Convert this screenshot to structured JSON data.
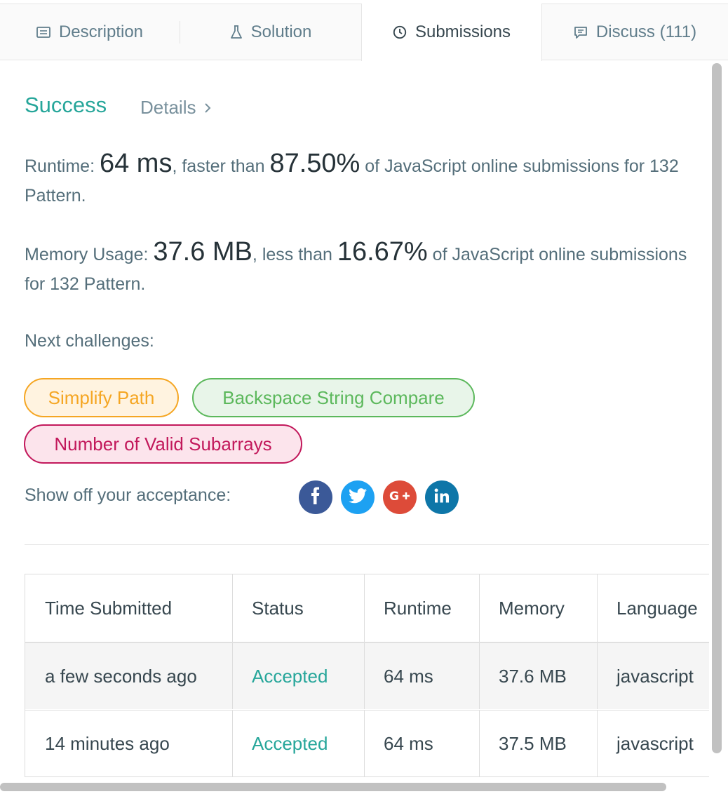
{
  "tabs": [
    {
      "label": "Description",
      "icon": "description-icon"
    },
    {
      "label": "Solution",
      "icon": "flask-icon"
    },
    {
      "label": "Submissions",
      "icon": "clock-icon",
      "active": true
    },
    {
      "label": "Discuss (111)",
      "icon": "comment-icon"
    }
  ],
  "result": {
    "status": "Success",
    "details_label": "Details",
    "runtime_label": "Runtime: ",
    "runtime_value": "64 ms",
    "runtime_mid": ", faster than ",
    "runtime_percent": "87.50%",
    "runtime_tail": " of JavaScript online submissions for 132 Pattern.",
    "memory_label": "Memory Usage: ",
    "memory_value": "37.6 MB",
    "memory_mid": ", less than ",
    "memory_percent": "16.67%",
    "memory_tail": " of JavaScript online submissions for 132 Pattern."
  },
  "next": {
    "label": "Next challenges:",
    "challenges": [
      {
        "title": "Simplify Path",
        "difficulty": "medium",
        "color": "#f5a623"
      },
      {
        "title": "Backspace String Compare",
        "difficulty": "easy",
        "color": "#5cb85c"
      },
      {
        "title": "Number of Valid Subarrays",
        "difficulty": "hard",
        "color": "#c2185b"
      }
    ]
  },
  "share": {
    "label": "Show off your acceptance:",
    "networks": [
      {
        "icon": "facebook-icon",
        "color": "#3b5998"
      },
      {
        "icon": "twitter-icon",
        "color": "#1da1f2"
      },
      {
        "icon": "google-plus-icon",
        "color": "#dd4b39"
      },
      {
        "icon": "linkedin-icon",
        "color": "#0e76a8"
      }
    ]
  },
  "table": {
    "headers": [
      "Time Submitted",
      "Status",
      "Runtime",
      "Memory",
      "Language"
    ],
    "rows": [
      [
        "a few seconds ago",
        "Accepted",
        "64 ms",
        "37.6 MB",
        "javascript"
      ],
      [
        "14 minutes ago",
        "Accepted",
        "64 ms",
        "37.5 MB",
        "javascript"
      ]
    ]
  },
  "colors": {
    "success": "#26a69a",
    "text": "#546e7a"
  }
}
